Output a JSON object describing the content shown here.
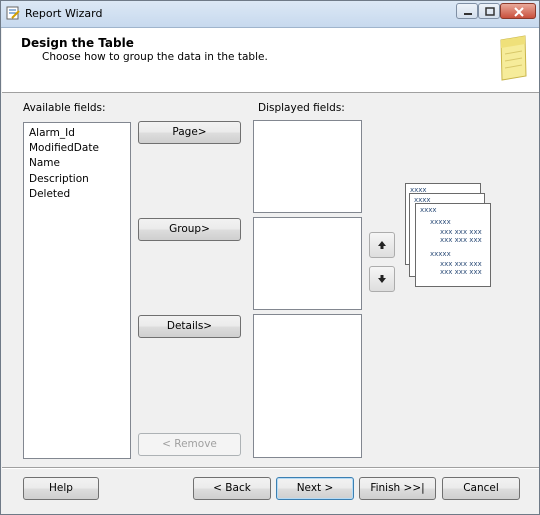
{
  "window": {
    "title": "Report Wizard"
  },
  "header": {
    "title": "Design the Table",
    "subtitle": "Choose how to group the data in the table."
  },
  "available": {
    "label": "Available fields:",
    "fields": [
      "Alarm_Id",
      "ModifiedDate",
      "Name",
      "Description",
      "Deleted"
    ]
  },
  "displayed": {
    "label": "Displayed fields:"
  },
  "buttons": {
    "page": "Page>",
    "group": "Group>",
    "details": "Details>",
    "remove": "< Remove"
  },
  "preview": {
    "header": "xxxx",
    "group": "xxxxx",
    "row": "xxx xxx xxx"
  },
  "footer": {
    "help": "Help",
    "back": "< Back",
    "next": "Next >",
    "finish": "Finish >>|",
    "cancel": "Cancel"
  }
}
